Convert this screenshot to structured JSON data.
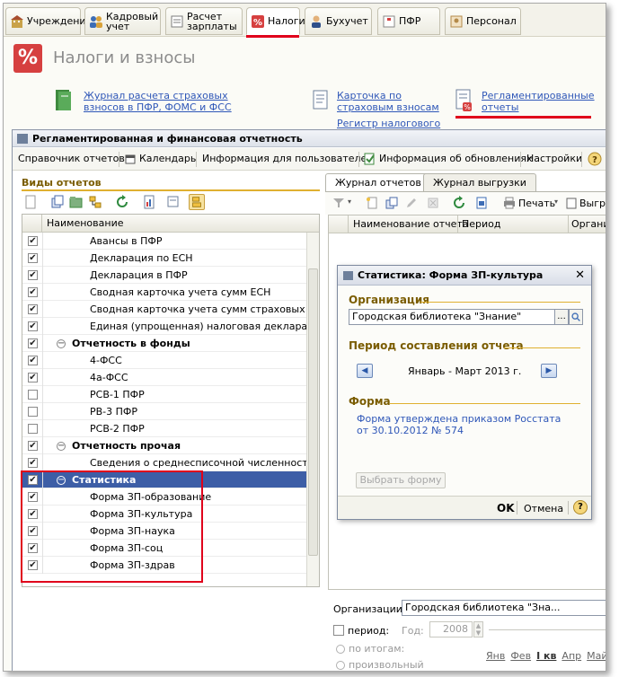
{
  "tabs": [
    {
      "label": "Учреждение",
      "icon": "building-icon",
      "active": false
    },
    {
      "label": "Кадровый\nучет",
      "icon": "people-icon",
      "active": false
    },
    {
      "label": "Расчет\nзарплаты",
      "icon": "payroll-icon",
      "active": false
    },
    {
      "label": "Налоги",
      "icon": "tax-percent-icon",
      "active": true
    },
    {
      "label": "Бухучет",
      "icon": "accountant-icon",
      "active": false
    },
    {
      "label": "ПФР",
      "icon": "pfr-icon",
      "active": false
    },
    {
      "label": "Персонал",
      "icon": "staff-icon",
      "active": false
    }
  ],
  "header": {
    "title": "Налоги и взносы"
  },
  "links": [
    {
      "label": "Журнал расчета страховых\nвзносов в ПФР, ФОМС и ФСС"
    },
    {
      "label": "Карточка по\nстраховым взносам"
    },
    {
      "label": "Регламентированные\nотчеты"
    },
    {
      "label": "Регистр налогового"
    }
  ],
  "window": {
    "title": "Регламентированная и финансовая отчетность",
    "commands": [
      "Справочник отчетов",
      "Календарь",
      "Информация для пользователей",
      "Информация об обновлениях",
      "Настройки"
    ],
    "left": {
      "section": "Виды отчетов",
      "column": "Наименование",
      "rows": [
        {
          "label": "Авансы в ПФР",
          "checked": true,
          "type": "item"
        },
        {
          "label": "Декларация по ЕСН",
          "checked": true,
          "type": "item"
        },
        {
          "label": "Декларация в ПФР",
          "checked": true,
          "type": "item"
        },
        {
          "label": "Сводная карточка учета сумм ЕСН",
          "checked": true,
          "type": "item"
        },
        {
          "label": "Сводная карточка учета сумм страховых взн...",
          "checked": true,
          "type": "item"
        },
        {
          "label": "Единая (упрощенная) налоговая декларация",
          "checked": true,
          "type": "item"
        },
        {
          "label": "Отчетность в фонды",
          "checked": true,
          "type": "group"
        },
        {
          "label": "4-ФСС",
          "checked": true,
          "type": "item"
        },
        {
          "label": "4а-ФСС",
          "checked": true,
          "type": "item"
        },
        {
          "label": "РСВ-1 ПФР",
          "checked": false,
          "type": "item"
        },
        {
          "label": "РВ-3 ПФР",
          "checked": false,
          "type": "item"
        },
        {
          "label": "РСВ-2 ПФР",
          "checked": false,
          "type": "item"
        },
        {
          "label": "Отчетность прочая",
          "checked": true,
          "type": "group"
        },
        {
          "label": "Сведения о среднесписочной численности",
          "checked": true,
          "type": "item"
        },
        {
          "label": "Статистика",
          "checked": true,
          "type": "group",
          "selected": true
        },
        {
          "label": "Форма ЗП-образование",
          "checked": true,
          "type": "item"
        },
        {
          "label": "Форма ЗП-культура",
          "checked": true,
          "type": "item"
        },
        {
          "label": "Форма ЗП-наука",
          "checked": true,
          "type": "item"
        },
        {
          "label": "Форма ЗП-соц",
          "checked": true,
          "type": "item"
        },
        {
          "label": "Форма ЗП-здрав",
          "checked": true,
          "type": "item"
        }
      ]
    },
    "right": {
      "tabs": [
        "Журнал отчетов",
        "Журнал выгрузки"
      ],
      "toolbar": {
        "print": "Печать",
        "export": "Выгру"
      },
      "columns": [
        "Наименование отчета",
        "Период",
        "Организ"
      ],
      "org_label": "Организации:",
      "org_value": "Городская библиотека \"Зна...",
      "period_label": "период:",
      "year_label": "Год:",
      "year_value": "2008",
      "by_totals": "по итогам:",
      "custom": "произвольный",
      "months": [
        "Янв",
        "Фев",
        "I кв",
        "Апр",
        "Май"
      ]
    }
  },
  "dialog": {
    "title": "Статистика: Форма ЗП-культура",
    "org_section": "Организация",
    "org_value": "Городская библиотека \"Знание\"",
    "period_section": "Период составления отчета",
    "period_value": "Январь - Март 2013 г.",
    "form_section": "Форма",
    "form_link": "Форма утверждена приказом Росстата от 30.10.2012 № 574",
    "choose_label": "Выбрать форму",
    "ok_label": "OK",
    "cancel_label": "Отмена",
    "help_label": "?"
  },
  "colors": {
    "accent_red": "#e0001b",
    "link_blue": "#2f57b8",
    "select_blue": "#3d5ea6",
    "section_gold": "#e0b030"
  }
}
